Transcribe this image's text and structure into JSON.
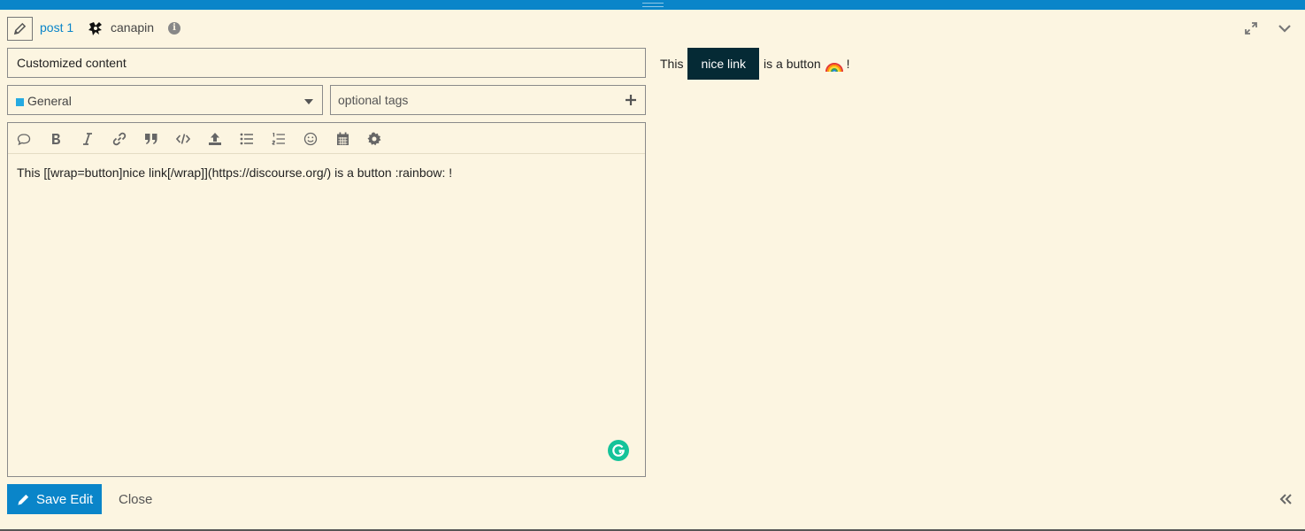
{
  "header": {
    "post_label": "post 1",
    "username": "canapin",
    "info_glyph": "i"
  },
  "title": {
    "value": "Customized content"
  },
  "category": {
    "label": "General",
    "color": "#25aae1"
  },
  "tags": {
    "placeholder": "optional tags"
  },
  "toolbar": {
    "icons": [
      "quote-icon",
      "bold-icon",
      "italic-icon",
      "link-icon",
      "blockquote-icon",
      "code-icon",
      "upload-icon",
      "bullet-list-icon",
      "numbered-list-icon",
      "emoji-icon",
      "calendar-icon",
      "gear-icon"
    ]
  },
  "editor": {
    "text": "This [[wrap=button]nice link[/wrap]](https://discourse.org/) is a button :rainbow: !"
  },
  "preview": {
    "before": "This",
    "button_label": "nice link",
    "after": "is a button",
    "end": "!"
  },
  "footer": {
    "save_label": "Save Edit",
    "close_label": "Close"
  },
  "colors": {
    "accent": "#0a85c9",
    "background": "#fcf5e1",
    "button_dark": "#052a35"
  }
}
